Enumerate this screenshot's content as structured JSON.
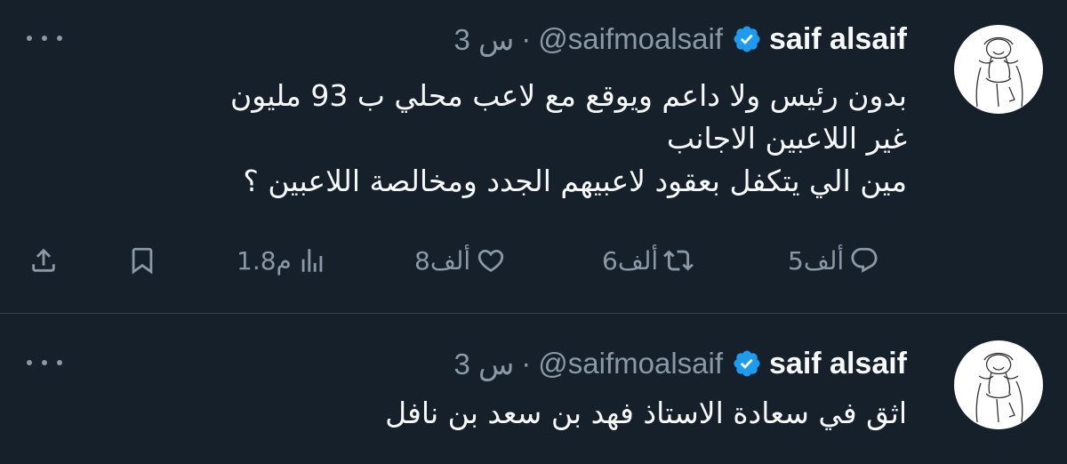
{
  "tweets": [
    {
      "name": "saif alsaif",
      "handle": "@saifmoalsaif",
      "separator": "·",
      "time": "3 س",
      "lines": [
        "بدون رئيس ولا داعم ويوقع مع لاعب محلي ب 93 مليون",
        "غير اللاعبين الاجانب",
        "مين الي يتكفل بعقود لاعبيهم الجدد ومخالصة اللاعبين ؟"
      ],
      "replies": "5ألف",
      "reposts": "6ألف",
      "likes": "8ألف",
      "views": "1.8م"
    },
    {
      "name": "saif alsaif",
      "handle": "@saifmoalsaif",
      "separator": "·",
      "time": "3 س",
      "lines": [
        "اثق في سعادة الاستاذ فهد بن سعد بن نافل"
      ]
    }
  ],
  "icons": {
    "verified": "verified-badge-icon",
    "more": "more-options-icon",
    "reply": "reply-icon",
    "repost": "repost-icon",
    "like": "like-icon",
    "views": "views-icon",
    "bookmark": "bookmark-icon",
    "share": "share-icon"
  },
  "colors": {
    "background": "#15202b",
    "text": "#f7f9f9",
    "secondary": "#8b98a5",
    "verified": "#1d9bf0",
    "divider": "#38444d"
  }
}
